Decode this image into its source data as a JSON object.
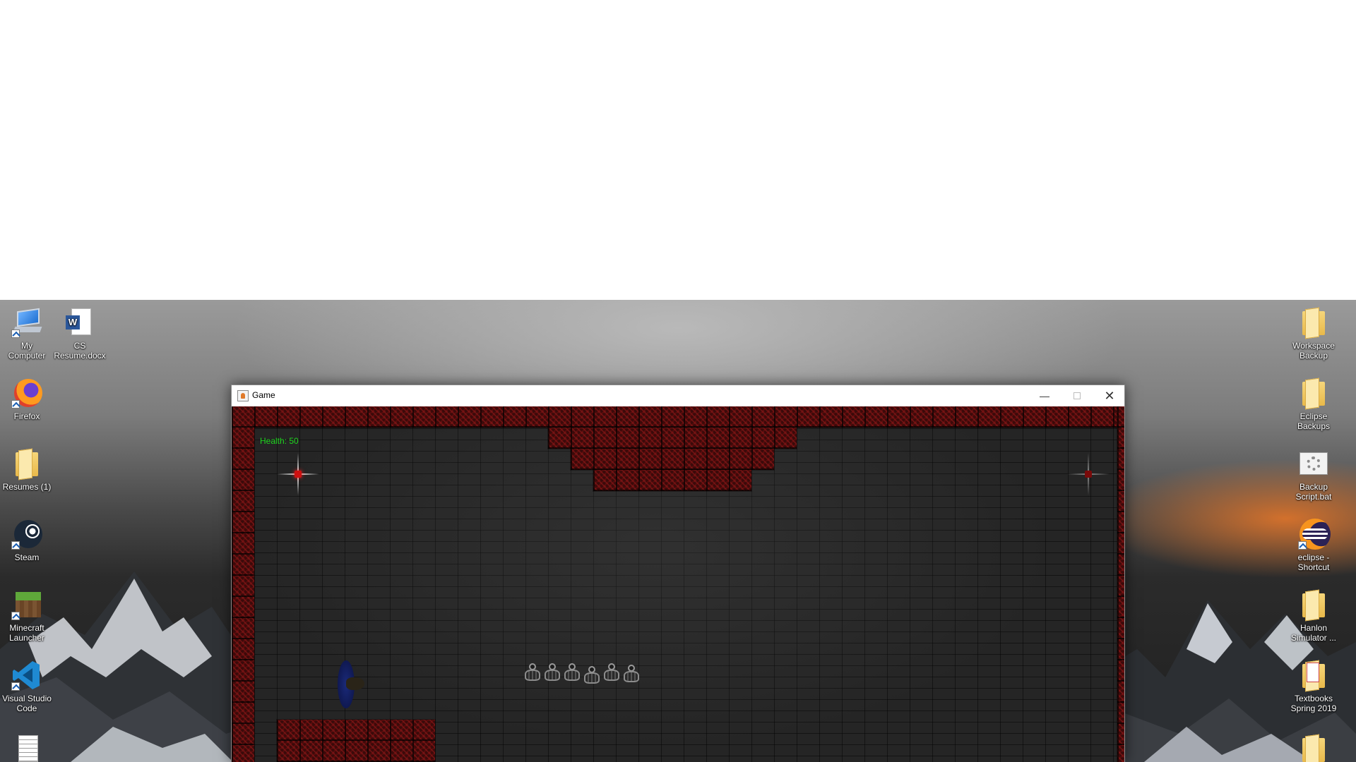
{
  "desktop": {
    "left_icons": [
      {
        "label": "My\nComputer",
        "icon": "computer-icon"
      },
      {
        "label": "CS\nResume.docx",
        "icon": "word-document-icon"
      },
      {
        "label": "Firefox",
        "icon": "firefox-icon"
      },
      {
        "label": "Resumes (1)",
        "icon": "folder-icon"
      },
      {
        "label": "Steam",
        "icon": "steam-icon"
      },
      {
        "label": "Minecraft\nLauncher",
        "icon": "minecraft-icon"
      },
      {
        "label": "Visual Studio\nCode",
        "icon": "vscode-icon"
      },
      {
        "label": "",
        "icon": "text-file-icon"
      }
    ],
    "right_icons": [
      {
        "label": "Workspace\nBackup",
        "icon": "folder-icon"
      },
      {
        "label": "Eclipse\nBackups",
        "icon": "folder-icon"
      },
      {
        "label": "Backup\nScript.bat",
        "icon": "batch-file-icon"
      },
      {
        "label": "eclipse -\nShortcut",
        "icon": "eclipse-icon"
      },
      {
        "label": "Hanlon\nSimulator ...",
        "icon": "folder-icon"
      },
      {
        "label": "Textbooks\nSpring 2019",
        "icon": "folder-icon"
      },
      {
        "label": "",
        "icon": "folder-icon"
      }
    ]
  },
  "window": {
    "title": "Game",
    "icon": "java-icon",
    "controls": {
      "minimize": "minimize-icon",
      "maximize": "maximize-icon",
      "close": "close-icon"
    }
  },
  "game": {
    "health_text": "Health: 50",
    "colors": {
      "health": "#1fd51f",
      "wall": "#3a0a0a",
      "floor": "#252525"
    },
    "enemy_count": 6
  }
}
